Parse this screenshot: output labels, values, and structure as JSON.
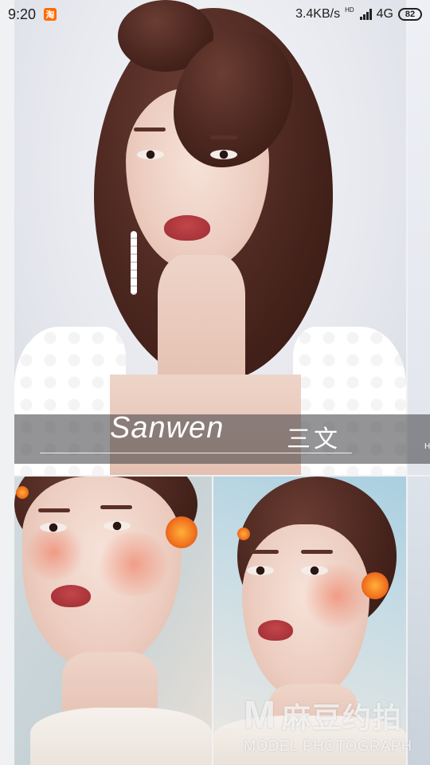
{
  "status_bar": {
    "time": "9:20",
    "app_icon": "淘",
    "net_speed": "3.4KB/s",
    "hd_label": "HD",
    "network": "4G",
    "battery": "82"
  },
  "hero": {
    "caption_en": "Sanwen",
    "caption_cn": "三文",
    "next_hint": "H"
  },
  "watermark": {
    "logo_letter": "M",
    "brand_cn": "麻豆约拍",
    "brand_en": "MODEL PHOTOGRAPH"
  },
  "colors": {
    "status_text": "#202020",
    "caption_band": "#3c3c40",
    "taobao_accent": "#ff6a00"
  }
}
